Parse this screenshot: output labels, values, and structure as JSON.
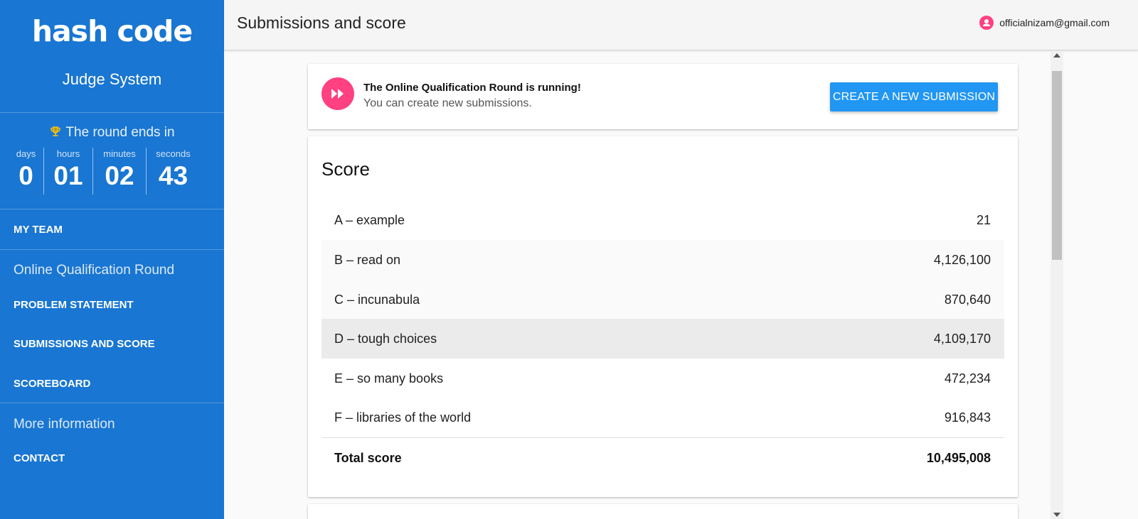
{
  "sidebar": {
    "logo": "hash code",
    "subtitle": "Judge System",
    "round_ends_label": "The round ends in",
    "countdown": [
      {
        "label": "days",
        "value": "0"
      },
      {
        "label": "hours",
        "value": "01"
      },
      {
        "label": "minutes",
        "value": "02"
      },
      {
        "label": "seconds",
        "value": "43"
      }
    ],
    "my_team": "MY TEAM",
    "section_round": "Online Qualification Round",
    "problem_statement": "PROBLEM STATEMENT",
    "submissions_and_score": "SUBMISSIONS AND SCORE",
    "scoreboard": "SCOREBOARD",
    "section_more": "More information",
    "contact": "CONTACT"
  },
  "header": {
    "title": "Submissions and score",
    "user_email": "officialnizam@gmail.com"
  },
  "status": {
    "title": "The Online Qualification Round is running!",
    "subtitle": "You can create new submissions.",
    "button_label": "CREATE A NEW SUBMISSION"
  },
  "score": {
    "title": "Score",
    "rows": [
      {
        "name": "A – example",
        "value": "21"
      },
      {
        "name": "B – read on",
        "value": "4,126,100"
      },
      {
        "name": "C – incunabula",
        "value": "870,640"
      },
      {
        "name": "D – tough choices",
        "value": "4,109,170"
      },
      {
        "name": "E – so many books",
        "value": "472,234"
      },
      {
        "name": "F – libraries of the world",
        "value": "916,843"
      }
    ],
    "total_label": "Total score",
    "total_value": "10,495,008"
  },
  "colors": {
    "sidebar": "#1976d2",
    "accent": "#ff4081",
    "button": "#2196f3"
  },
  "icons": {
    "trophy": "trophy-icon",
    "user": "account-circle-icon",
    "status": "fast-forward-icon"
  }
}
